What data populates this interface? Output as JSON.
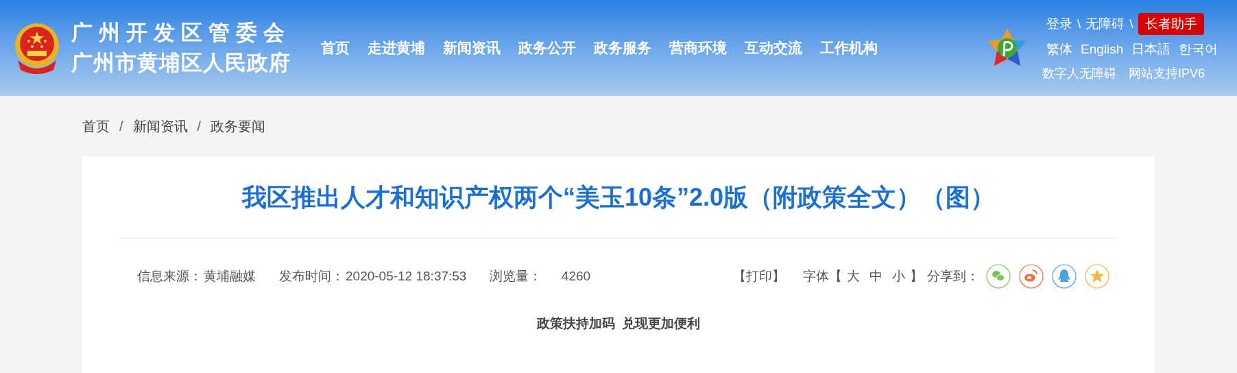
{
  "header": {
    "site_name_lines": [
      "广州开发区管委会",
      "广州市黄埔区人民政府"
    ],
    "nav": [
      "首页",
      "走进黄埔",
      "新闻资讯",
      "政务公开",
      "政务服务",
      "营商环境",
      "互动交流",
      "工作机构"
    ],
    "top_links": [
      {
        "kind": "link",
        "text": "登录"
      },
      {
        "kind": "separator",
        "text": "\\"
      },
      {
        "kind": "link",
        "text": "无障碍"
      },
      {
        "kind": "separator",
        "text": "\\"
      },
      {
        "kind": "badge",
        "text": "长者助手"
      }
    ],
    "languages": [
      "繁体",
      "English",
      "日本語",
      "한국어"
    ],
    "extra_links": [
      "数字人无障碍",
      "网站支持IPV6"
    ]
  },
  "breadcrumb": [
    {
      "kind": "link",
      "text": "首页"
    },
    {
      "kind": "separator",
      "text": "/"
    },
    {
      "kind": "link",
      "text": "新闻资讯"
    },
    {
      "kind": "separator",
      "text": "/"
    },
    {
      "kind": "link",
      "text": "政务要闻"
    }
  ],
  "article": {
    "title": "我区推出人才和知识产权两个“美玉10条”2.0版（附政策全文）（图）",
    "meta": [
      {
        "label": "信息来源：",
        "value": "黄埔融媒"
      },
      {
        "label": "发布时间：",
        "value": "2020-05-12 18:37:53"
      },
      {
        "label": "浏览量：",
        "value": "4260"
      }
    ],
    "print": "【打印】",
    "font_size": {
      "label": "字体",
      "open": "【",
      "sizes": [
        "大",
        "中",
        "小"
      ],
      "close": "】"
    },
    "share_label": "分享到：",
    "share": [
      {
        "kind": "wechat",
        "color": "#7bc35b"
      },
      {
        "kind": "weibo",
        "color": "#e8704a"
      },
      {
        "kind": "qq",
        "color": "#4aa3df"
      },
      {
        "kind": "qzone",
        "color": "#f0b73b"
      }
    ],
    "subtitle": "政策扶持加码  兑现更加便利"
  }
}
